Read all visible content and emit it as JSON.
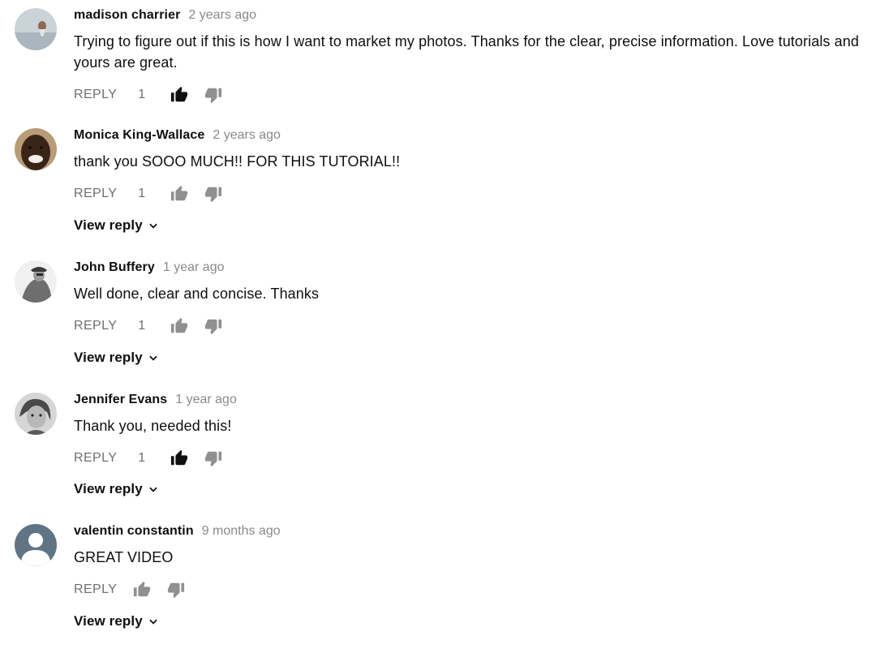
{
  "comments": [
    {
      "author": "madison charrier",
      "time": "2 years ago",
      "text": "Trying to figure out if this is how I want to market my photos.  Thanks for the clear, precise information.  Love tutorials and yours are great.",
      "reply_label": "REPLY",
      "likes": "1",
      "liked": true,
      "view_reply": ""
    },
    {
      "author": "Monica King-Wallace",
      "time": "2 years ago",
      "text": "thank you SOOO MUCH!! FOR THIS TUTORIAL!!",
      "reply_label": "REPLY",
      "likes": "1",
      "liked": false,
      "view_reply": "View reply"
    },
    {
      "author": "John Buffery",
      "time": "1 year ago",
      "text": "Well done, clear and concise. Thanks",
      "reply_label": "REPLY",
      "likes": "1",
      "liked": false,
      "view_reply": "View reply"
    },
    {
      "author": "Jennifer Evans",
      "time": "1 year ago",
      "text": "Thank you, needed this!",
      "reply_label": "REPLY",
      "likes": "1",
      "liked": true,
      "view_reply": "View reply"
    },
    {
      "author": "valentin constantin",
      "time": "9 months ago",
      "text": "GREAT  VIDEO",
      "reply_label": "REPLY",
      "likes": "",
      "liked": false,
      "view_reply": "View reply"
    }
  ],
  "icons": {
    "like": "thumbs-up-icon",
    "dislike": "thumbs-down-icon",
    "expand": "chevron-down-icon"
  },
  "colors": {
    "liked": "#0f0f0f",
    "unliked": "#909090",
    "muted": "#6f6f6f"
  }
}
